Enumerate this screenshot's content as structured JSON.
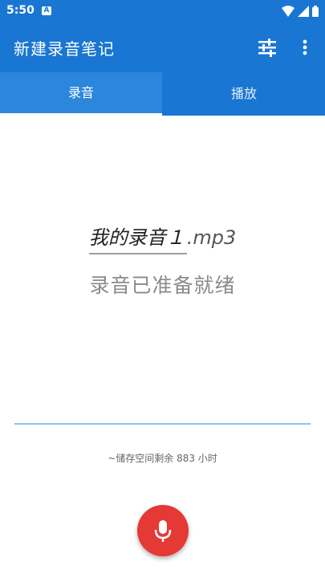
{
  "status_bar": {
    "time": "5:50",
    "notification_badge": "A"
  },
  "app_bar": {
    "title": "新建录音笔记"
  },
  "tabs": [
    {
      "label": "录音"
    },
    {
      "label": "播放"
    }
  ],
  "recorder": {
    "filename": "我的录音１",
    "extension": ".mp3",
    "status": "录音已准备就绪",
    "storage": "~储存空间剩余 883 小时"
  },
  "colors": {
    "primary": "#1976d2",
    "record": "#e53935",
    "level_line": "#90c2ea"
  }
}
